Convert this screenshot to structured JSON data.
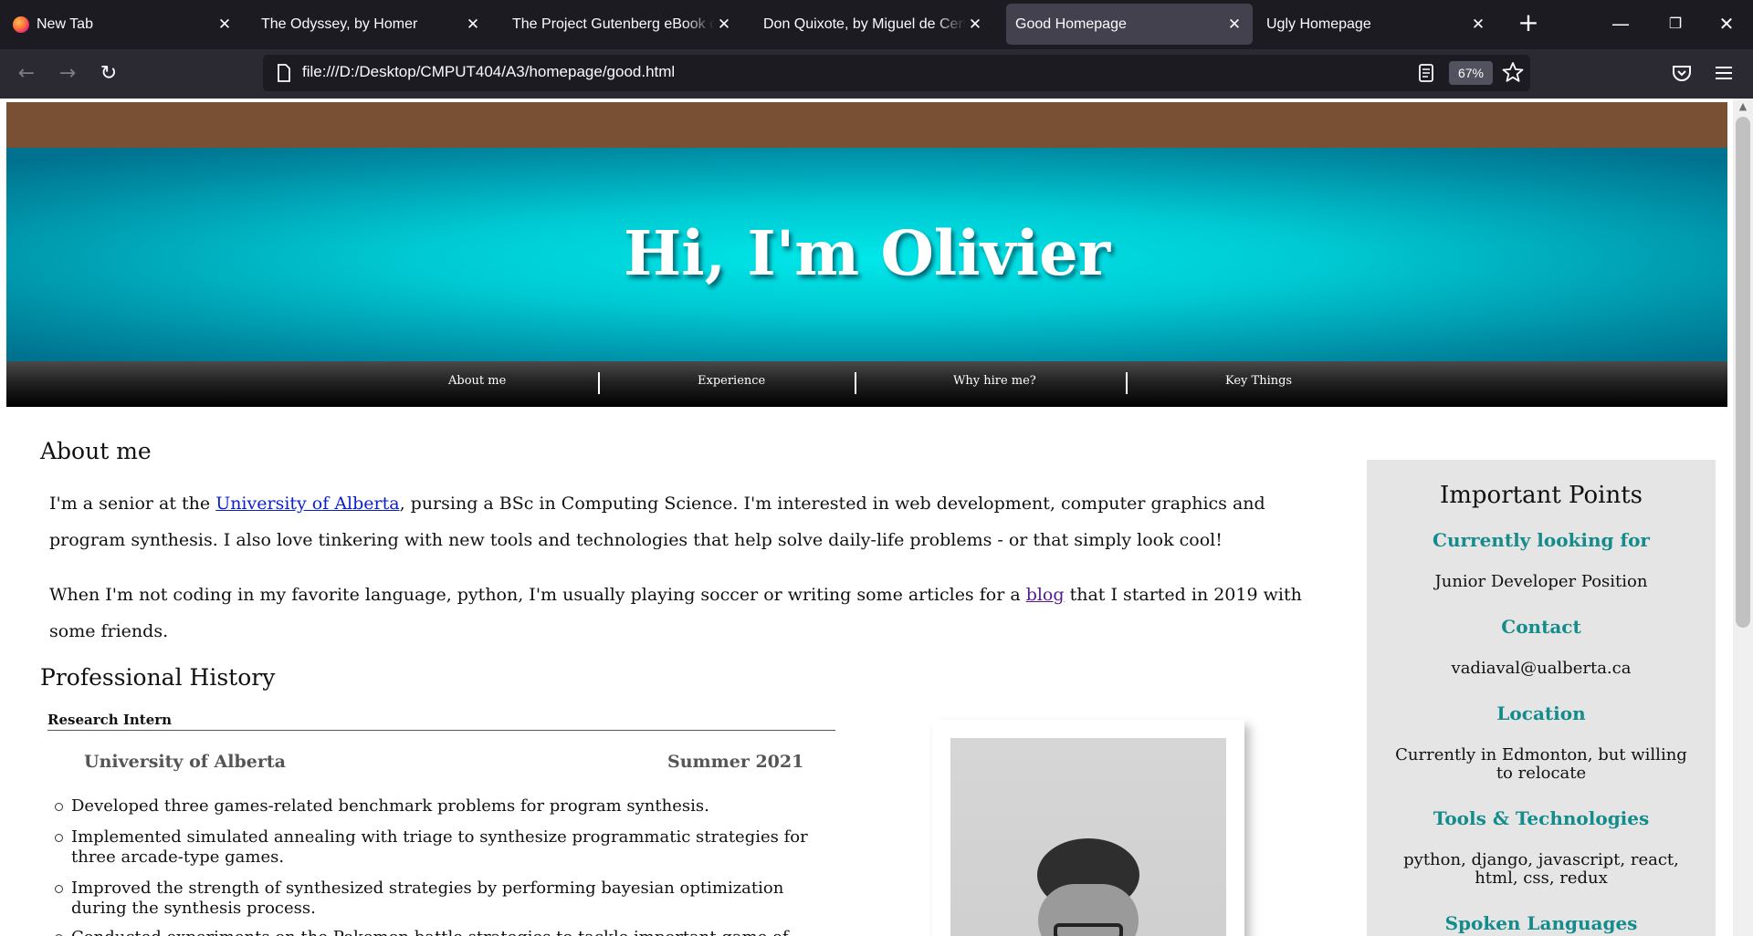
{
  "tabs": [
    {
      "title": "New Tab"
    },
    {
      "title": "The Odyssey, by Homer"
    },
    {
      "title": "The Project Gutenberg eBook of Don Quixote"
    },
    {
      "title": "Don Quixote, by Miguel de Cervantes"
    },
    {
      "title": "Good Homepage"
    },
    {
      "title": "Ugly Homepage"
    }
  ],
  "active_tab_index": 4,
  "url": "file:///D:/Desktop/CMPUT404/A3/homepage/good.html",
  "zoom": "67%",
  "icons": {
    "back": "arrow-left-icon",
    "forward": "arrow-right-icon",
    "reload": "reload-icon",
    "page": "page-icon",
    "reader": "reader-view-icon",
    "bookmark": "star-icon",
    "pocket": "pocket-icon",
    "menu": "hamburger-menu-icon"
  },
  "page": {
    "hero_title": "Hi, I'm Olivier",
    "nav": [
      "About me",
      "Experience",
      "Why hire me?",
      "Key Things"
    ],
    "about": {
      "heading": "About me",
      "p1_before": "I'm a senior at the ",
      "p1_link": "University of Alberta",
      "p1_after": ", pursing a BSc in Computing Science. I'm interested in web development, computer graphics and program synthesis. I also love tinkering with new tools and technologies that help solve daily-life problems - or that simply look cool!",
      "p2_before": "When I'm not coding in my favorite language, python, I'm usually playing soccer or writing some articles for a ",
      "p2_link": "blog",
      "p2_after": " that I started in 2019 with some friends."
    },
    "history": {
      "heading": "Professional History",
      "job_title": "Research Intern",
      "org": "University of Alberta",
      "date": "Summer 2021",
      "bullets": [
        "Developed three games-related benchmark problems for program synthesis.",
        "Implemented simulated annealing with triage to synthesize programmatic strategies for three arcade-type games.",
        "Improved the strength of synthesized strategies by performing bayesian optimization during the synthesis process.",
        "Conducted experiments on the Pokemon battle strategies to tackle important game of triangular"
      ]
    },
    "sidebar": {
      "title": "Important Points",
      "sections": [
        {
          "heading": "Currently looking for",
          "text": "Junior Developer Position"
        },
        {
          "heading": "Contact",
          "text": "vadiaval@ualberta.ca"
        },
        {
          "heading": "Location",
          "text": "Currently in Edmonton, but willing to relocate"
        },
        {
          "heading": "Tools & Technologies",
          "text": "python, django, javascript, react, html, css, redux"
        },
        {
          "heading": "Spoken Languages",
          "text": ""
        }
      ]
    }
  },
  "colors": {
    "tab_bg": "#1c1b22",
    "active_tab": "#42414d",
    "accent_teal": "#148c8c",
    "brown_strip": "#7a5034",
    "sidebar_bg": "#e5e5e5"
  }
}
